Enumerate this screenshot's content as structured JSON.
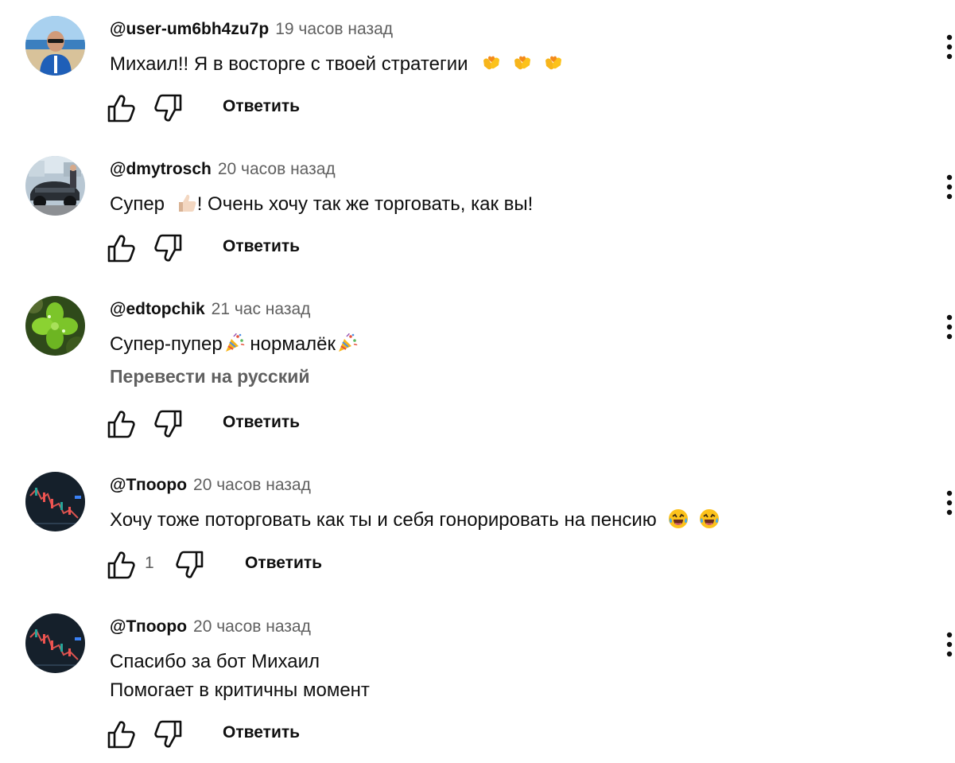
{
  "comments": [
    {
      "author": "@user-um6bh4zu7p",
      "time": "19 часов назад",
      "lines": [
        "Михаил!! Я в восторге с твоей стратегии"
      ],
      "emoji": [
        "hands-heart-emoji",
        "hands-heart-emoji",
        "hands-heart-emoji"
      ],
      "reply_label": "Ответить",
      "avatar": "man-at-beach-avatar"
    },
    {
      "author": "@dmytrosch",
      "time": "20 часов назад",
      "text_before": "Супер",
      "text_after": "! Очень хочу так же торговать, как вы!",
      "emoji": [
        "thumbs-up-emoji"
      ],
      "reply_label": "Ответить",
      "avatar": "car-photo-avatar"
    },
    {
      "author": "@edtopchik",
      "time": "21 час назад",
      "part1": "Супер-пупер",
      "part2": " нормалёк",
      "emoji": [
        "party-popper-emoji",
        "party-popper-emoji"
      ],
      "translate_label": "Перевести на русский",
      "reply_label": "Ответить",
      "avatar": "clover-avatar"
    },
    {
      "author": "@Тпooрo",
      "time": "20 часов назад",
      "lines": [
        "Хочу тоже поторговать как ты и себя  гонорировать на пенсию"
      ],
      "emoji": [
        "laughing-emoji",
        "laughing-emoji"
      ],
      "like_count": "1",
      "reply_label": "Ответить",
      "avatar": "trading-chart-avatar"
    },
    {
      "author": "@Тпooрo",
      "time": "20 часов назад",
      "lines": [
        "Спасибо за бот Михаил",
        "Помогает в  критичны момент"
      ],
      "reply_label": "Ответить",
      "avatar": "trading-chart-avatar"
    }
  ],
  "colors": {
    "text": "#0f0f0f",
    "secondary": "#606060"
  }
}
